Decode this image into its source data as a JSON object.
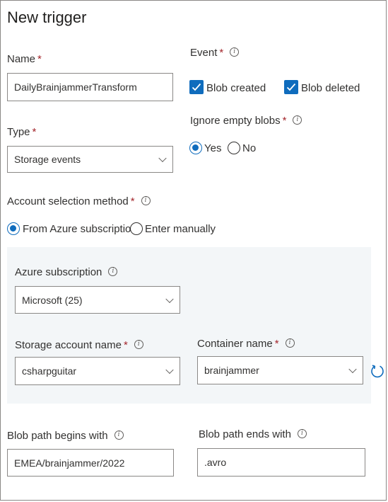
{
  "title": "New trigger",
  "name": {
    "label": "Name",
    "required": "*",
    "value": "DailyBrainjammerTransform"
  },
  "type": {
    "label": "Type",
    "required": "*",
    "value": "Storage events"
  },
  "event": {
    "label": "Event",
    "required": "*",
    "options": [
      {
        "label": "Blob created",
        "checked": true
      },
      {
        "label": "Blob deleted",
        "checked": true
      }
    ]
  },
  "ignore_empty": {
    "label": "Ignore empty blobs",
    "required": "*",
    "options": [
      {
        "label": "Yes",
        "selected": true
      },
      {
        "label": "No",
        "selected": false
      }
    ]
  },
  "account_method": {
    "label": "Account selection method",
    "required": "*",
    "options": [
      {
        "label": "From Azure subscription",
        "selected": true
      },
      {
        "label": "Enter manually",
        "selected": false
      }
    ]
  },
  "azure_subscription": {
    "label": "Azure subscription",
    "value": "Microsoft (25)"
  },
  "storage_account": {
    "label": "Storage account name",
    "required": "*",
    "value": "csharpguitar"
  },
  "container": {
    "label": "Container name",
    "required": "*",
    "value": "brainjammer"
  },
  "blob_begins": {
    "label": "Blob path begins with",
    "value": "EMEA/brainjammer/2022"
  },
  "blob_ends": {
    "label": "Blob path ends with",
    "value": ".avro"
  },
  "icons": {
    "info": "i",
    "refresh": "refresh-icon",
    "checkmark": "checkmark-icon",
    "chevron": "chevron-down-icon"
  },
  "colors": {
    "accent": "#0f6cbd",
    "required": "#a4262c",
    "panel": "#f3f6f8"
  }
}
